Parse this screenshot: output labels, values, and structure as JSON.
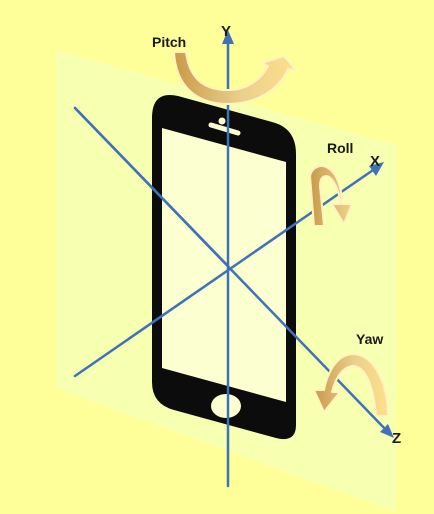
{
  "diagram": {
    "colors": {
      "background": "#ffff99",
      "plane": "#f7ffb0",
      "phone": "#0c0c0c",
      "screen": "#fcffd0",
      "axis": "#3f72b8",
      "arrow_fill": "#ddb86e",
      "arrow_outline": "#fff3c0"
    },
    "axes": [
      {
        "label": "Y"
      },
      {
        "label": "X"
      },
      {
        "label": "Z"
      }
    ],
    "rotations": [
      {
        "label": "Pitch"
      },
      {
        "label": "Roll"
      },
      {
        "label": "Yaw"
      }
    ]
  }
}
